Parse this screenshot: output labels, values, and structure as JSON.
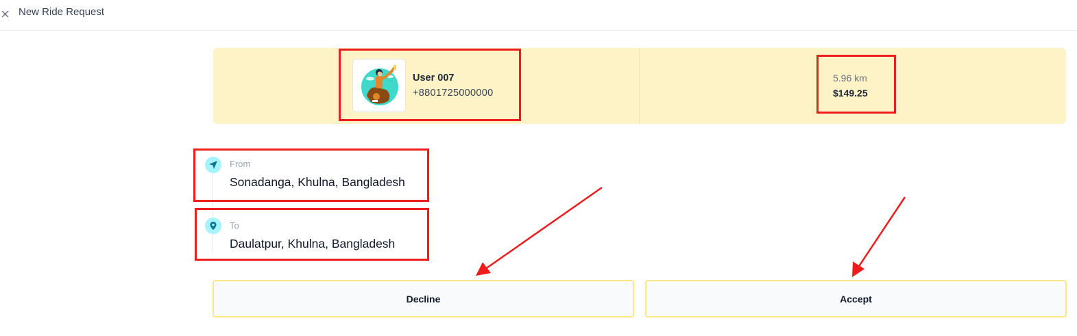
{
  "header": {
    "title": "New Ride Request",
    "close_icon": "close-icon"
  },
  "rider": {
    "name": "User 007",
    "phone": "+8801725000000",
    "avatar_icon": "avatar-illustration"
  },
  "trip": {
    "distance": "5.96 km",
    "fare": "$149.25"
  },
  "route": {
    "from": {
      "label": "From",
      "address": "Sonadanga, Khulna, Bangladesh",
      "icon": "navigation-arrow-icon"
    },
    "to": {
      "label": "To",
      "address": "Daulatpur, Khulna, Bangladesh",
      "icon": "location-pin-icon"
    }
  },
  "actions": {
    "decline_label": "Decline",
    "accept_label": "Accept"
  },
  "colors": {
    "card_background": "#fef3c7",
    "button_border": "#fde68a",
    "pin_background": "#a5f3fc",
    "annotation_red": "#ee1c1c"
  }
}
